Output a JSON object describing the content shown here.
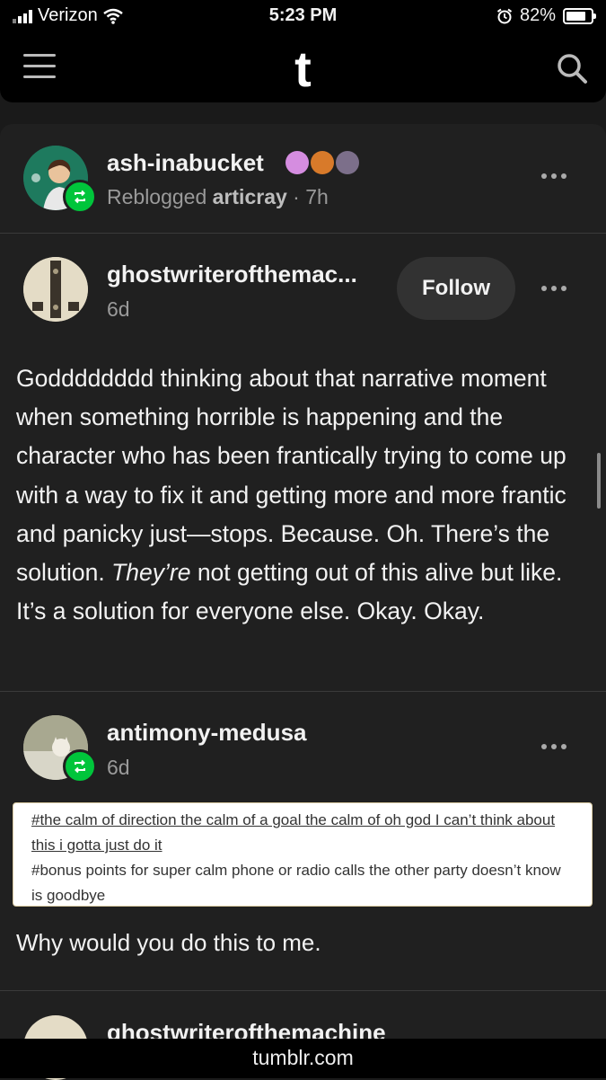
{
  "status_bar": {
    "carrier": "Verizon",
    "time": "5:23 PM",
    "battery": "82%",
    "battery_level": 0.82
  },
  "nav": {
    "logo": "t"
  },
  "reblogger": {
    "username": "ash-inabucket",
    "reblogged_label": "Reblogged",
    "source": "articray",
    "time": "· 7h"
  },
  "original_post": {
    "username": "ghostwriterofthemac...",
    "time": "6d",
    "follow_label": "Follow",
    "text_before_italic": "Godddddddd thinking about that narrative moment when something horrible is happening and the character who has been frantically trying to come up with a way to fix it and getting more and more frantic and panicky just—stops. Because. Oh. There’s the solution. ",
    "text_italic": "They’re",
    "text_after_italic": " not getting out of this alive but like. It’s a solution for everyone else. Okay. Okay."
  },
  "reply_post": {
    "username": "antimony-medusa",
    "time": "6d",
    "tag1": "#the calm of direction the calm of a goal the calm of oh god I can’t think about this i gotta just do it",
    "tag2": "#bonus points for super calm phone or radio calls the other party doesn’t know is goodbye",
    "text": "Why would you do this to me."
  },
  "next_post": {
    "username": "ghostwriterofthemachine"
  },
  "url_bar": {
    "url": "tumblr.com"
  },
  "colors": {
    "background": "#1a1a1a",
    "card": "#202020",
    "reblog_green": "#00c53b"
  }
}
